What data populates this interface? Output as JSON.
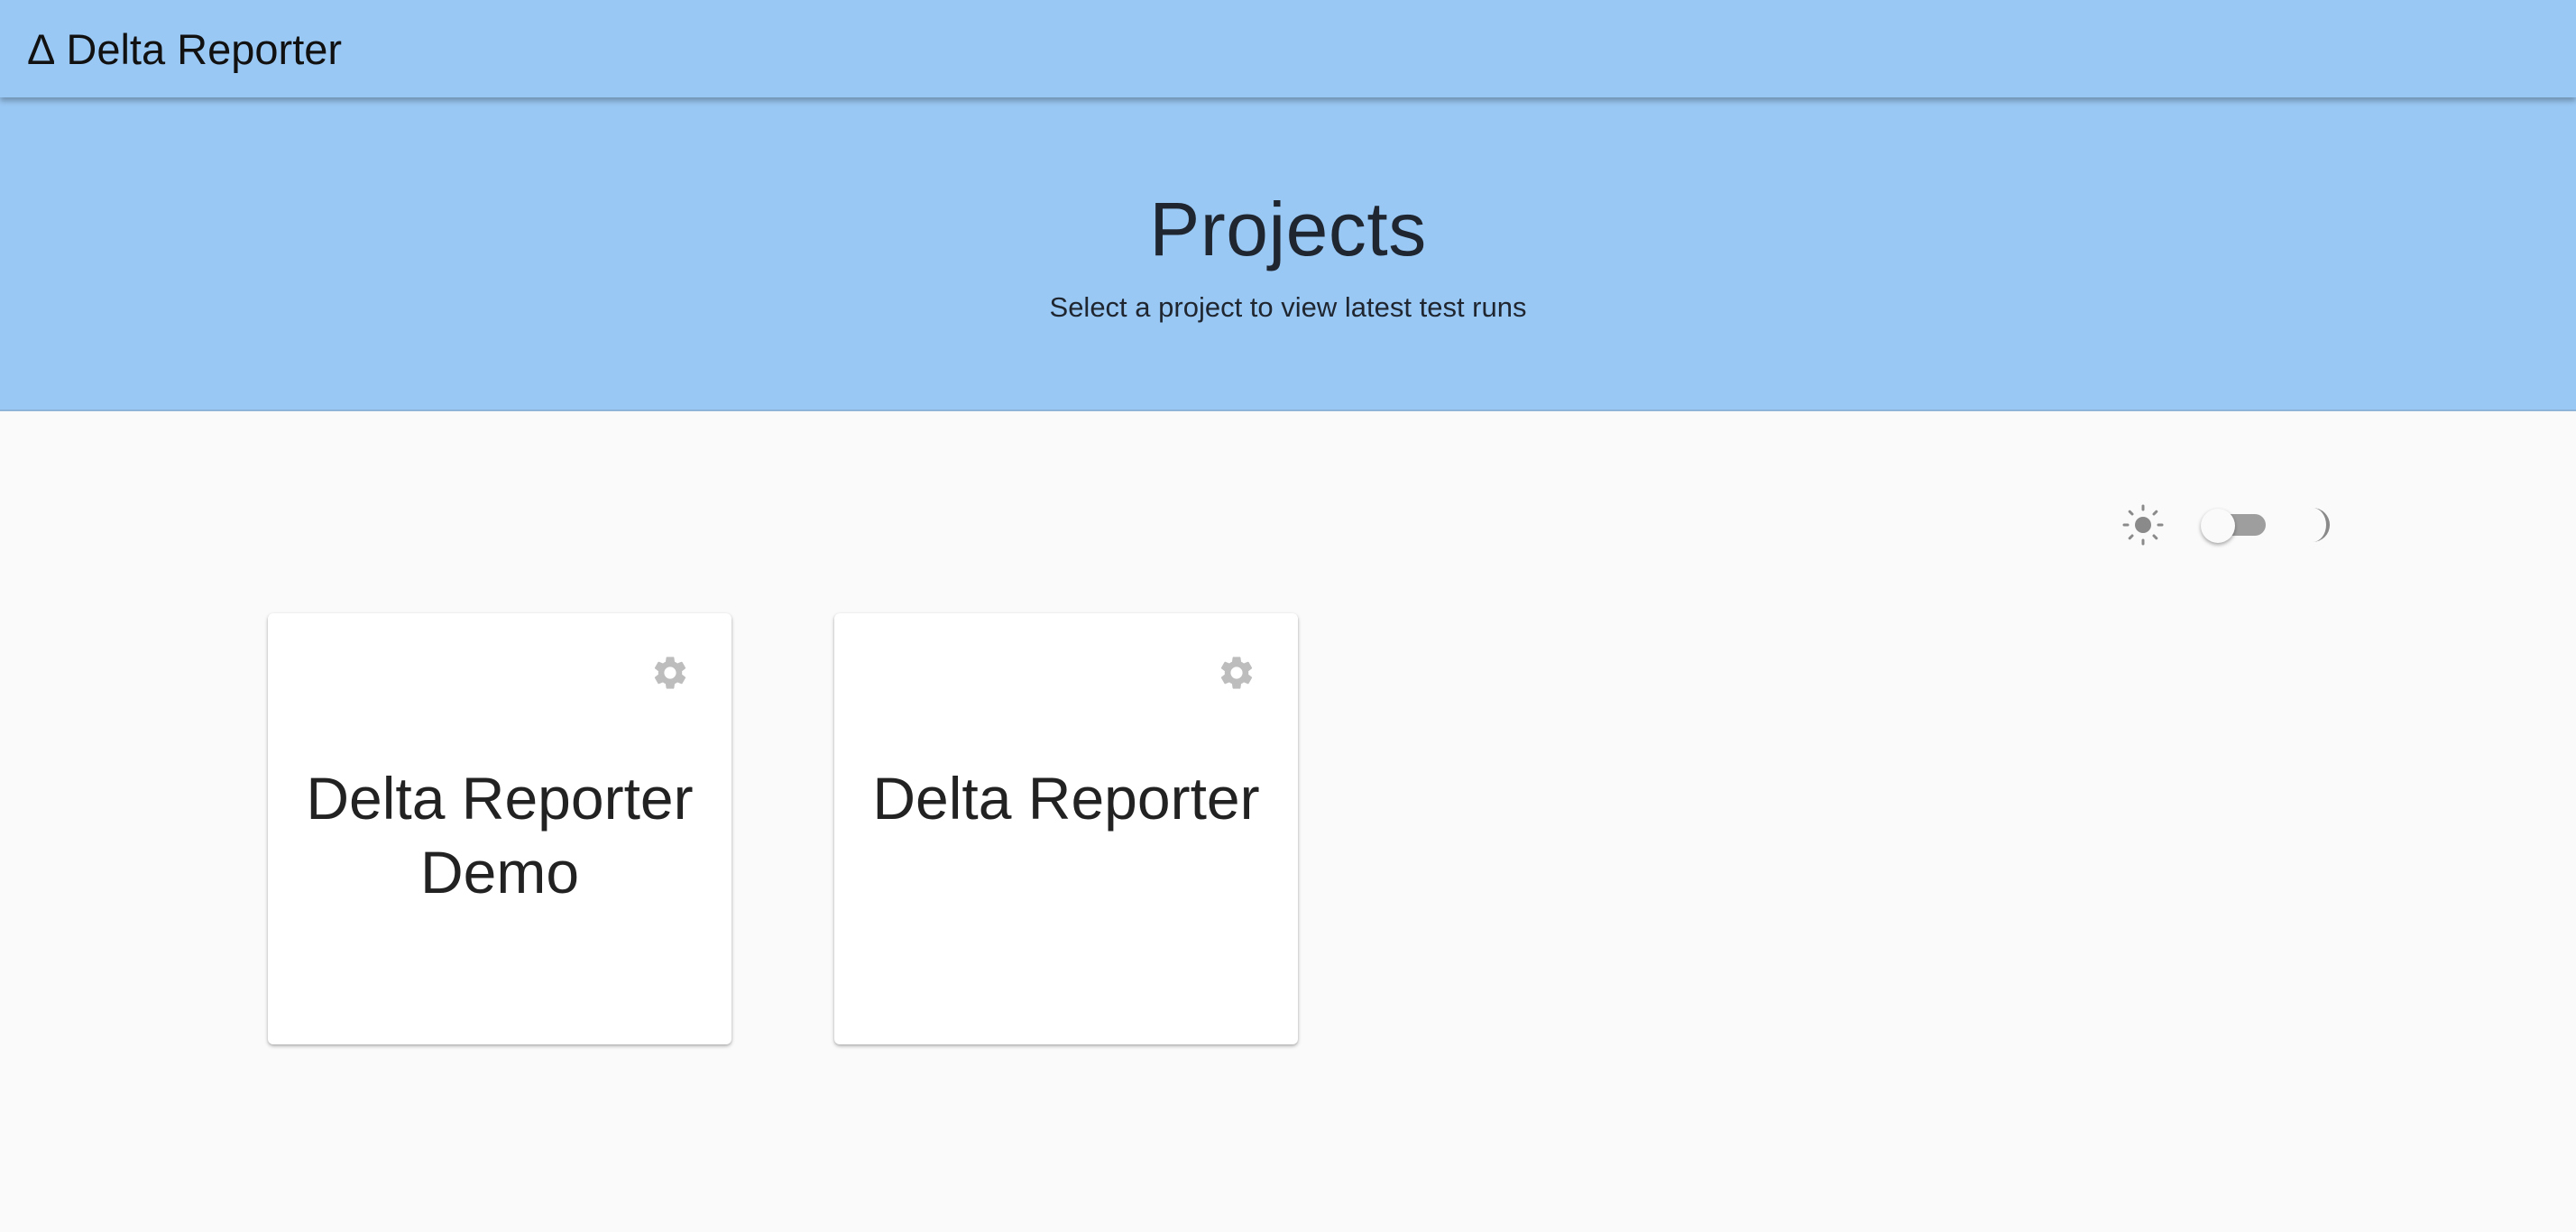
{
  "app_bar": {
    "logo_symbol": "Δ",
    "title": "Delta Reporter",
    "background": "#9ac8f4"
  },
  "hero": {
    "title": "Projects",
    "subtitle": "Select a project to view latest test runs"
  },
  "theme_toggle": {
    "light_icon": "sun-icon",
    "dark_icon": "moon-icon",
    "dark_mode_on": false
  },
  "projects": [
    {
      "name": "Delta Reporter Demo",
      "settings_icon": "gear-icon"
    },
    {
      "name": "Delta Reporter",
      "settings_icon": "gear-icon"
    }
  ]
}
